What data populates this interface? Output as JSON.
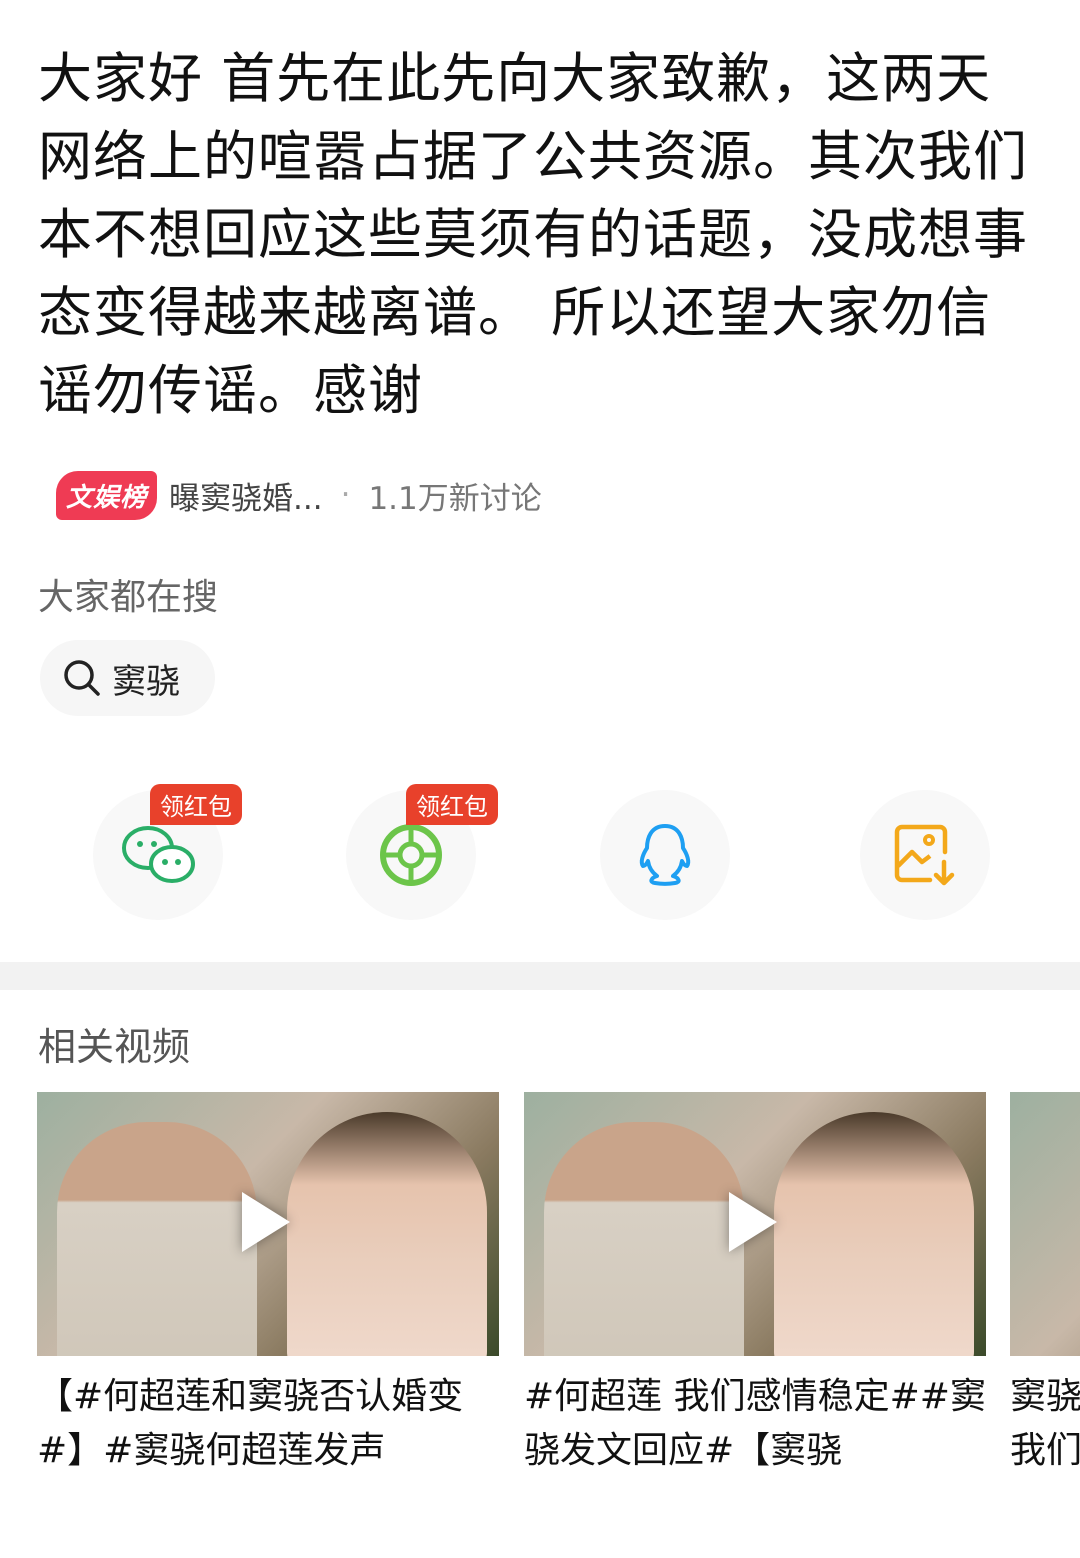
{
  "post": {
    "text": "大家好 首先在此先向大家致歉，这两天网络上的喧嚣占据了公共资源。其次我们本不想回应这些莫须有的话题，没成想事态变得越来越离谱。 所以还望大家勿信谣勿传谣。感谢"
  },
  "hot": {
    "badge": "文娱榜",
    "topic": "曝窦骁婚...",
    "separator": "·",
    "count": "1.1万新讨论"
  },
  "search": {
    "section_title": "大家都在搜",
    "chip_label": "窦骁"
  },
  "share": {
    "tag_label": "领红包",
    "items": [
      {
        "icon": "wechat-icon",
        "color": "#2aae67"
      },
      {
        "icon": "moments-icon",
        "color": "#6cc54a"
      },
      {
        "icon": "qq-icon",
        "color": "#1e9ff2"
      },
      {
        "icon": "save-image-icon",
        "color": "#f3a81a"
      }
    ]
  },
  "related": {
    "section_title": "相关视频",
    "videos": [
      {
        "title": "【#何超莲和窦骁否认婚变#】#窦骁何超莲发声"
      },
      {
        "title": "#何超莲 我们感情稳定##窦骁发文回应#【窦骁"
      },
      {
        "title": "窦骁 我们"
      }
    ]
  }
}
